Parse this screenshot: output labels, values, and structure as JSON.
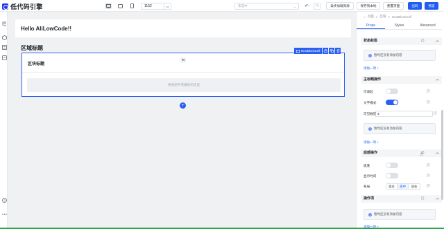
{
  "app": {
    "name": "低代码引擎"
  },
  "toolbar": {
    "devices": [
      "desktop-icon",
      "tablet-icon",
      "phone-icon"
    ],
    "canvas_width": "1152",
    "width_unit": "px",
    "locale_placeholder": "未选中",
    "async_button": "异步加载资源",
    "save_local_button": "保存到本地",
    "reset_button": "重置页面",
    "publish_button": "出码",
    "preview_button": "预览"
  },
  "canvas": {
    "hello_text": "Hello AliLowCode!!",
    "area_title": "区域标题",
    "block_title": "区块标题",
    "drop_hint": "拖拽组件或模板到这里",
    "selected_component": "NextBlockCell"
  },
  "panel": {
    "breadcrumb": [
      "页面",
      "区域",
      "NextBlockCell"
    ],
    "tabs": [
      "Props",
      "Styles",
      "Advanced"
    ],
    "active_tab": "Props",
    "sections": {
      "state": {
        "title": "状态标签",
        "var": "{/}",
        "empty": "暂时还没有添加内容",
        "add": "添加一项 +"
      },
      "main_ops": {
        "title": "主标题操作",
        "var": "{/}",
        "collapsible_label": "可收起",
        "text_mode_label": "文字模式",
        "visible_count_label": "可见数量",
        "visible_count_value": "3",
        "empty": "暂时还没有添加内容",
        "add": "添加一项 +"
      },
      "bottom_ops": {
        "title": "底部操作",
        "var": "{/}",
        "fixed_label": "吸底",
        "show_time_label": "显示时间",
        "layout_label": "布局",
        "layout_options": [
          "居左",
          "居中",
          "居右"
        ],
        "layout_selected": "居中"
      },
      "op_items": {
        "title": "操作项",
        "var": "{/}",
        "empty": "暂时还没有添加内容",
        "add": "添加一项 +"
      }
    }
  }
}
